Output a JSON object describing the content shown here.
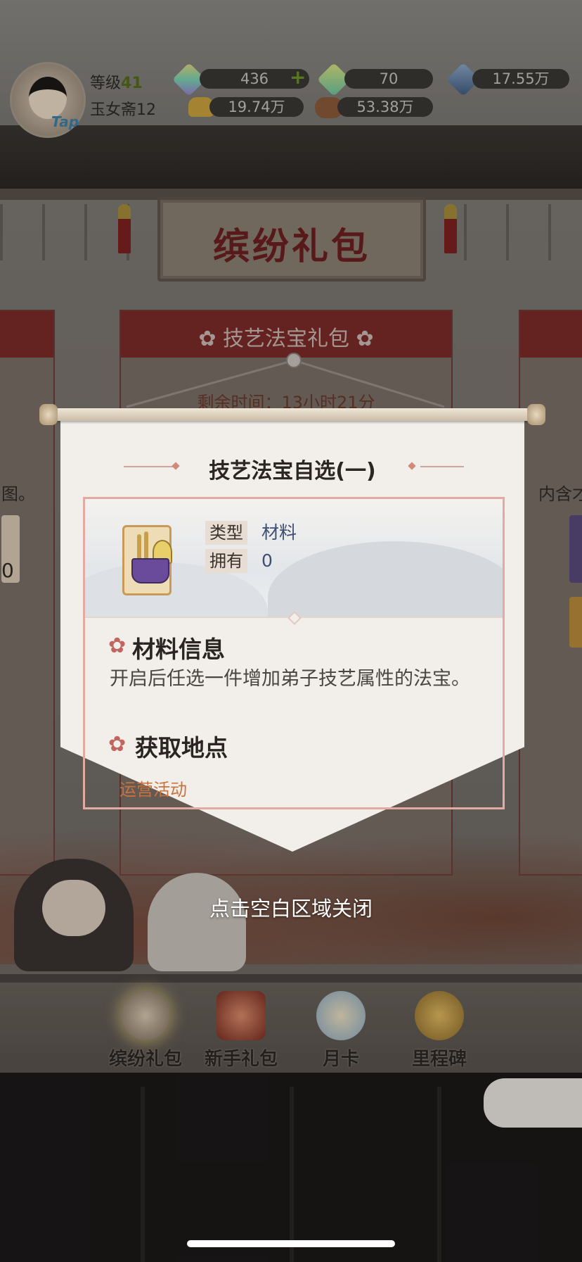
{
  "hud": {
    "level_label": "等级",
    "level_value": "41",
    "sect_name": "玉女斋12",
    "avatar_tap": "Tap",
    "resources": [
      {
        "name": "rainbow-gem",
        "value": "436",
        "has_plus": true
      },
      {
        "name": "green-gem",
        "value": "70"
      },
      {
        "name": "blue-crystal",
        "value": "17.55万"
      },
      {
        "name": "gold-ingot",
        "value": "19.74万"
      },
      {
        "name": "copper-coin",
        "value": "53.38万"
      }
    ]
  },
  "background": {
    "banner_title": "缤纷礼包",
    "pack_title": "技艺法宝礼包",
    "timer": "剩余时间：13小时21分",
    "left_card_fragment": "图。",
    "left_card_number": "0",
    "right_card_fragment": "内含才"
  },
  "modal": {
    "title": "技艺法宝自选(一)",
    "item": {
      "type_label": "类型",
      "type_value": "材料",
      "own_label": "拥有",
      "own_value": "0",
      "icon": "treasure-basket-icon"
    },
    "info_title": "材料信息",
    "info_text": "开启后任选一件增加弟子技艺属性的法宝。",
    "source_title": "获取地点",
    "source_value": "运营活动"
  },
  "close_hint": "点击空白区域关闭",
  "tabs": [
    {
      "label": "缤纷礼包",
      "active": true
    },
    {
      "label": "新手礼包"
    },
    {
      "label": "月卡"
    },
    {
      "label": "里程碑"
    }
  ],
  "colors": {
    "accent_red": "#7a2a28",
    "source_orange": "#c8723e",
    "frame_pink": "#e2aaa0"
  }
}
